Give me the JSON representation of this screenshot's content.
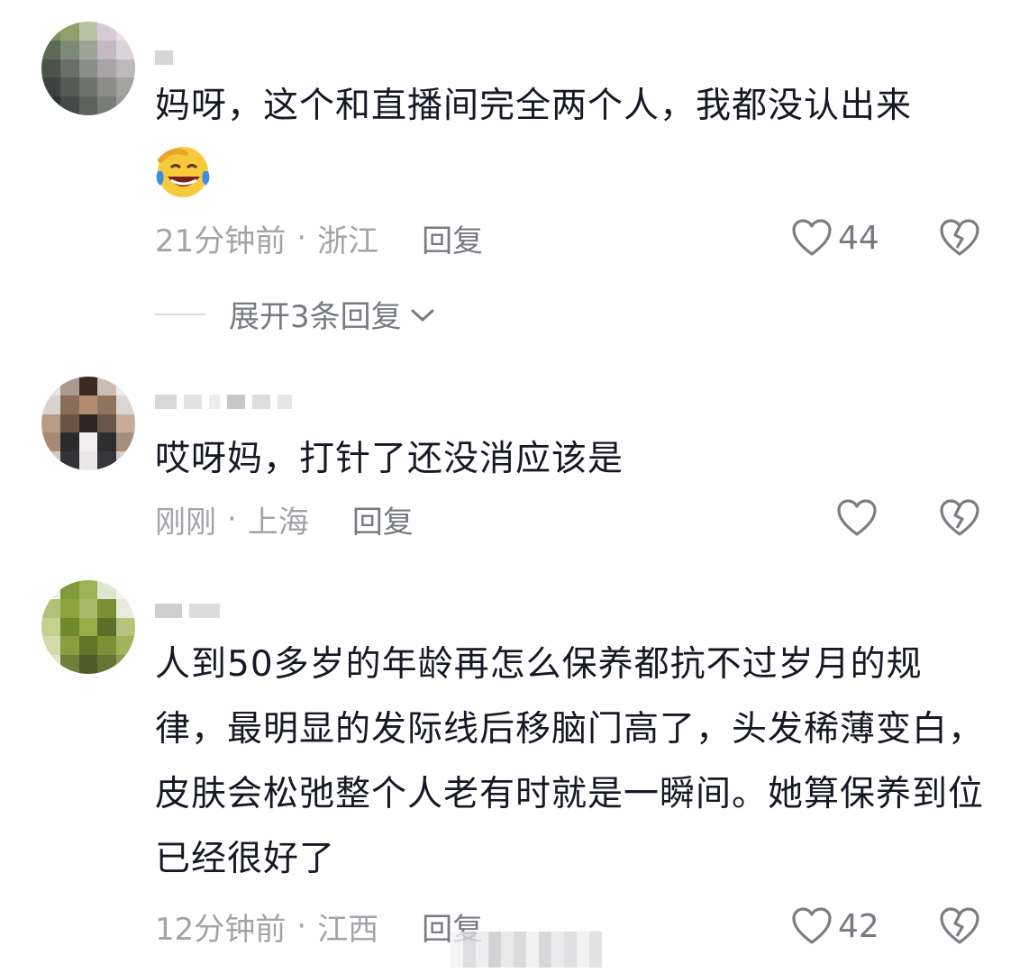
{
  "comments": [
    {
      "text": "妈呀，这个和直播间完全两个人，我都没认出来",
      "has_emoji": true,
      "emoji": "laughing-crying",
      "time": "21分钟前",
      "location": "浙江",
      "reply_label": "回复",
      "likes": "44",
      "expand_label": "展开3条回复"
    },
    {
      "text": "哎呀妈，打针了还没消应该是",
      "time": "刚刚",
      "location": "上海",
      "reply_label": "回复",
      "likes": ""
    },
    {
      "text": "人到50多岁的年龄再怎么保养都抗不过岁月的规律，最明显的发际线后移脑门高了，头发稀薄变白，皮肤会松弛整个人老有时就是一瞬间。她算保养到位已经很好了",
      "time": "12分钟前",
      "location": "江西",
      "reply_label": "回复",
      "likes": "42"
    }
  ],
  "separator": "·",
  "colors": {
    "text": "#161823",
    "meta": "#a3a3a8",
    "action": "#777a80"
  },
  "icons": [
    "heart-outline-icon",
    "broken-heart-icon",
    "chevron-down-icon"
  ]
}
